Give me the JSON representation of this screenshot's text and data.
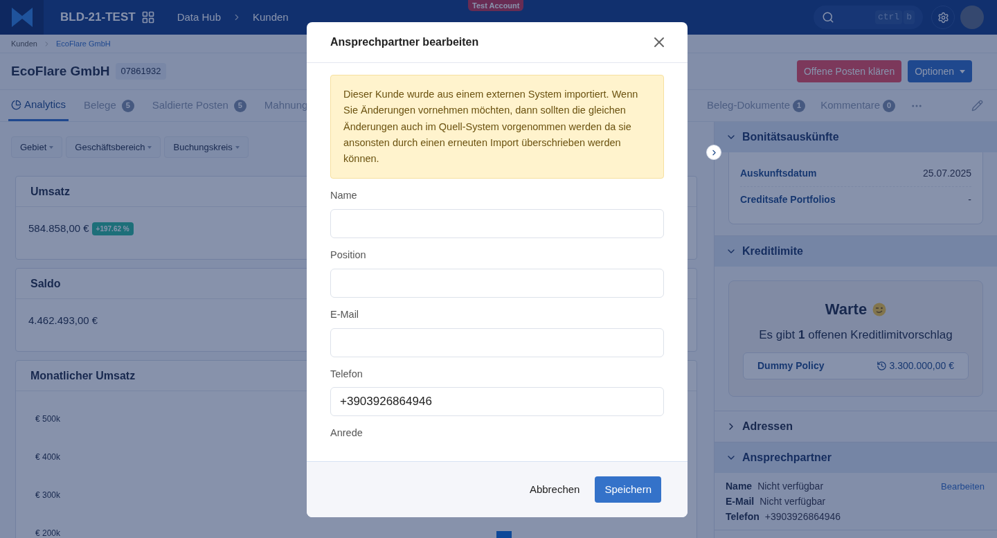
{
  "topbar": {
    "app_name": "BLD-21-TEST",
    "path": [
      "Data Hub",
      "Kunden"
    ],
    "environment_badge": "Test Account",
    "search": {
      "shortcut_keys": [
        "ctrl",
        "b"
      ]
    }
  },
  "breadcrumb": [
    {
      "label": "Kunden",
      "selected": false
    },
    {
      "label": "EcoFlare GmbH",
      "selected": true
    }
  ],
  "customer": {
    "name": "EcoFlare GmbH",
    "number": "07861932"
  },
  "actions": [
    {
      "label": "Offene Posten klären",
      "kind": "danger"
    },
    {
      "label": "Optionen",
      "kind": "menu"
    }
  ],
  "tabs": [
    {
      "label": "Analytics",
      "kind": "chart",
      "selected": true
    },
    {
      "label": "Belege",
      "count": "5",
      "kind": "text",
      "selected": false
    },
    {
      "label": "Saldierte Posten",
      "count": "5",
      "kind": "text",
      "selected": false
    },
    {
      "label": "Mahnung",
      "kind": "text",
      "selected": false
    }
  ],
  "tabs_right": [
    {
      "label": "Beleg-Dokumente",
      "count": "1",
      "selected": false
    },
    {
      "label": "Kommentare",
      "count": "0",
      "selected": false
    }
  ],
  "filters": [
    "Gebiet",
    "Geschäftsbereich",
    "Buchungskreis"
  ],
  "cards": [
    {
      "title": "Umsatz",
      "value": "584.858,00 €",
      "change": "+197.62 %"
    },
    {
      "title": "Saldo",
      "value": "4.462.493,00 €"
    }
  ],
  "chart_card": {
    "title": "Monatlicher Umsatz",
    "axis_labels": [
      "€ 500k",
      "€ 400k",
      "€ 300k",
      "€ 200k"
    ]
  },
  "sidebar": [
    {
      "title": "Bonitätsauskünfte",
      "expanded": true,
      "kind": "facts",
      "rows": [
        {
          "label": "Auskunftsdatum",
          "value": "25.07.2025"
        },
        {
          "label": "Creditsafe Portfolios",
          "value": "-"
        }
      ]
    },
    {
      "title": "Kreditlimite",
      "expanded": true,
      "kind": "credit",
      "heading": "Warte",
      "text": "Es gibt **1** offenen Kreditlimitvorschlag",
      "policy": {
        "name": "Dummy Policy",
        "amount": "3.300.000,00 €"
      }
    },
    {
      "title": "Adressen",
      "expanded": false
    },
    {
      "title": "Ansprechpartner",
      "expanded": true,
      "kind": "contact",
      "edit_link": "Bearbeiten",
      "rows": [
        {
          "label": "Name",
          "value": "Nicht verfügbar"
        },
        {
          "label": "E-Mail",
          "value": "Nicht verfügbar"
        },
        {
          "label": "Telefon",
          "value": "+3903926864946"
        }
      ]
    }
  ],
  "modal": {
    "title": "Ansprechpartner bearbeiten",
    "notice": "Dieser Kunde wurde aus einem externen System importiert. Wenn Sie Änderungen vornehmen möchten, dann sollten die gleichen Änderungen auch im Quell-System vorgenommen werden da sie ansonsten durch einen erneuten Import überschrieben werden können.",
    "fields": [
      {
        "label": "Name",
        "kind": "input"
      },
      {
        "label": "Position",
        "kind": "input"
      },
      {
        "label": "E-Mail",
        "kind": "input"
      },
      {
        "label": "Telefon",
        "kind": "input",
        "value": "+3903926864946"
      },
      {
        "label": "Anrede",
        "kind": "label"
      }
    ],
    "buttons": [
      {
        "label": "Abbrechen",
        "kind": "secondary"
      },
      {
        "label": "Speichern",
        "kind": "primary"
      }
    ]
  }
}
